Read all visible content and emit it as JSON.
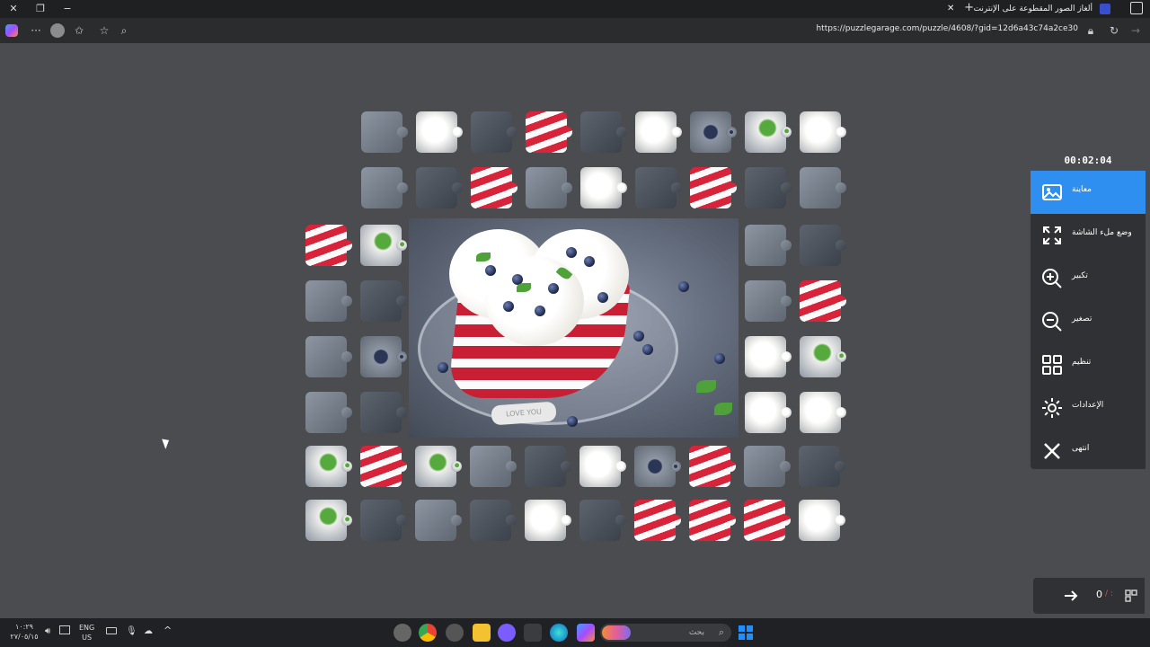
{
  "browser": {
    "tab_title": "ألغاز الصور المقطوعة على الإنترنت",
    "url": "https://puzzlegarage.com/puzzle/4608/?gid=12d6a43c74a2ce30"
  },
  "preview": {
    "plate_text": "LOVE YOU"
  },
  "timer": "00:02:04",
  "side_menu": {
    "items": [
      {
        "label": "معاينة",
        "icon": "image-icon",
        "active": true
      },
      {
        "label": "وضع ملء الشاشة",
        "icon": "fullscreen-icon",
        "active": false
      },
      {
        "label": "تكبير",
        "icon": "zoom-in-icon",
        "active": false
      },
      {
        "label": "تصغير",
        "icon": "zoom-out-icon",
        "active": false
      },
      {
        "label": "تنظيم",
        "icon": "grid-icon",
        "active": false
      },
      {
        "label": "الإعدادات",
        "icon": "gear-icon",
        "active": false
      },
      {
        "label": "انتهى",
        "icon": "close-icon",
        "active": false
      }
    ]
  },
  "bottom_panel": {
    "counter": "0",
    "counter_suffix": "/ :"
  },
  "taskbar": {
    "search_placeholder": "بحث",
    "lang_top": "ENG",
    "lang_bottom": "US",
    "time": "١٠:٢٩",
    "date": "٢٧/٠٥/١٥"
  },
  "colors": {
    "accent": "#2f8ff0",
    "background": "#4a4c50",
    "panel": "#2f3134"
  }
}
